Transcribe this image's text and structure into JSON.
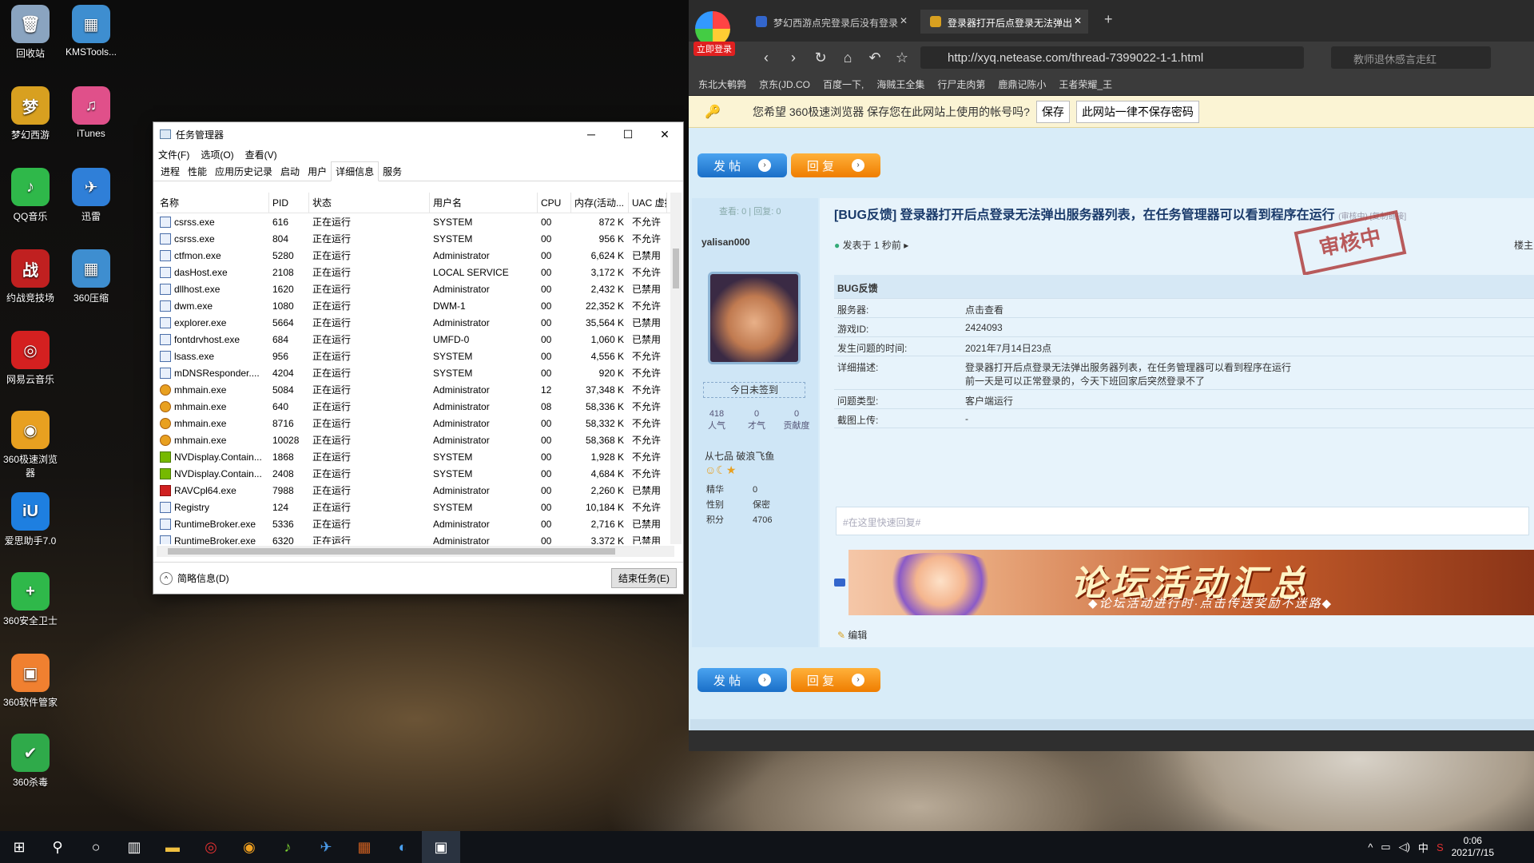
{
  "desktop": {
    "icons": [
      {
        "label": "回收站",
        "color": "#8aa4c0",
        "glyph": "🗑"
      },
      {
        "label": "KMSTools...",
        "color": "#3e8ed0",
        "glyph": "▦"
      },
      {
        "label": "梦幻西游",
        "color": "#d8a020",
        "glyph": "梦"
      },
      {
        "label": "iTunes",
        "color": "#e0508a",
        "glyph": "♫"
      },
      {
        "label": "QQ音乐",
        "color": "#2fb84a",
        "glyph": "♪"
      },
      {
        "label": "迅雷",
        "color": "#2f7fd8",
        "glyph": "✈"
      },
      {
        "label": "约战竞技场",
        "color": "#c02020",
        "glyph": "战"
      },
      {
        "label": "360压缩",
        "color": "#3e8ed0",
        "glyph": "▦"
      },
      {
        "label": "网易云音乐",
        "color": "#d42020",
        "glyph": "◎"
      },
      {
        "label": "360极速浏览器",
        "color": "#e8a020",
        "glyph": "◉"
      },
      {
        "label": "爱思助手7.0",
        "color": "#1e7fe0",
        "glyph": "iU"
      },
      {
        "label": "360安全卫士",
        "color": "#2fb84a",
        "glyph": "+"
      },
      {
        "label": "360软件管家",
        "color": "#f08030",
        "glyph": "▣"
      },
      {
        "label": "360杀毒",
        "color": "#2faa4a",
        "glyph": "✔"
      }
    ]
  },
  "task_manager": {
    "title": "任务管理器",
    "menu": [
      "文件(F)",
      "选项(O)",
      "查看(V)"
    ],
    "tabs": [
      "进程",
      "性能",
      "应用历史记录",
      "启动",
      "用户",
      "详细信息",
      "服务"
    ],
    "active_tab": "详细信息",
    "columns": [
      "名称",
      "PID",
      "状态",
      "用户名",
      "CPU",
      "内存(活动...",
      "UAC 虚拟"
    ],
    "rows": [
      [
        "csrss.exe",
        "616",
        "正在运行",
        "SYSTEM",
        "00",
        "872 K",
        "不允许"
      ],
      [
        "csrss.exe",
        "804",
        "正在运行",
        "SYSTEM",
        "00",
        "956 K",
        "不允许"
      ],
      [
        "ctfmon.exe",
        "5280",
        "正在运行",
        "Administrator",
        "00",
        "6,624 K",
        "已禁用"
      ],
      [
        "dasHost.exe",
        "2108",
        "正在运行",
        "LOCAL SERVICE",
        "00",
        "3,172 K",
        "不允许"
      ],
      [
        "dllhost.exe",
        "1620",
        "正在运行",
        "Administrator",
        "00",
        "2,432 K",
        "已禁用"
      ],
      [
        "dwm.exe",
        "1080",
        "正在运行",
        "DWM-1",
        "00",
        "22,352 K",
        "不允许"
      ],
      [
        "explorer.exe",
        "5664",
        "正在运行",
        "Administrator",
        "00",
        "35,564 K",
        "已禁用"
      ],
      [
        "fontdrvhost.exe",
        "684",
        "正在运行",
        "UMFD-0",
        "00",
        "1,060 K",
        "已禁用"
      ],
      [
        "lsass.exe",
        "956",
        "正在运行",
        "SYSTEM",
        "00",
        "4,556 K",
        "不允许"
      ],
      [
        "mDNSResponder....",
        "4204",
        "正在运行",
        "SYSTEM",
        "00",
        "920 K",
        "不允许"
      ],
      [
        "mhmain.exe",
        "5084",
        "正在运行",
        "Administrator",
        "12",
        "37,348 K",
        "不允许"
      ],
      [
        "mhmain.exe",
        "640",
        "正在运行",
        "Administrator",
        "08",
        "58,336 K",
        "不允许"
      ],
      [
        "mhmain.exe",
        "8716",
        "正在运行",
        "Administrator",
        "00",
        "58,332 K",
        "不允许"
      ],
      [
        "mhmain.exe",
        "10028",
        "正在运行",
        "Administrator",
        "00",
        "58,368 K",
        "不允许"
      ],
      [
        "NVDisplay.Contain...",
        "1868",
        "正在运行",
        "SYSTEM",
        "00",
        "1,928 K",
        "不允许"
      ],
      [
        "NVDisplay.Contain...",
        "2408",
        "正在运行",
        "SYSTEM",
        "00",
        "4,684 K",
        "不允许"
      ],
      [
        "RAVCpl64.exe",
        "7988",
        "正在运行",
        "Administrator",
        "00",
        "2,260 K",
        "已禁用"
      ],
      [
        "Registry",
        "124",
        "正在运行",
        "SYSTEM",
        "00",
        "10,184 K",
        "不允许"
      ],
      [
        "RuntimeBroker.exe",
        "5336",
        "正在运行",
        "Administrator",
        "00",
        "2,716 K",
        "已禁用"
      ],
      [
        "RuntimeBroker.exe",
        "6320",
        "正在运行",
        "Administrator",
        "00",
        "3,372 K",
        "已禁用"
      ]
    ],
    "footer_less": "简略信息(D)",
    "footer_end": "结束任务(E)"
  },
  "browser": {
    "login_badge": "立即登录",
    "tabs": [
      "梦幻西游点完登录后没有登录",
      "登录器打开后点登录无法弹出"
    ],
    "url": "http://xyq.netease.com/thread-7399022-1-1.html",
    "search_placeholder": "教师退休感言走红",
    "bookmarks": [
      "东北大鹌鹑",
      "京东(JD.CO",
      "百度一下,",
      "海贼王全集",
      "行尸走肉第",
      "鹿鼎记陈小",
      "王者荣耀_王"
    ],
    "password_prompt": "您希望 360极速浏览器 保存您在此网站上使用的帐号吗?",
    "save_btn": "保存",
    "never_btn": "此网站一律不保存密码",
    "post_btn": "发 帖",
    "reply_btn": "回 复",
    "views": "查看: 0",
    "replies": "回复: 0",
    "author": "yalisan000",
    "checkin": "今日未签到",
    "stats": [
      {
        "value": "418",
        "label": "人气"
      },
      {
        "value": "0",
        "label": "才气"
      },
      {
        "value": "0",
        "label": "贡献度"
      }
    ],
    "rank": "从七品 破浪飞鱼",
    "profile": [
      {
        "k": "精华",
        "v": "0"
      },
      {
        "k": "性别",
        "v": "保密"
      },
      {
        "k": "积分",
        "v": "4706"
      }
    ],
    "post_title": "[BUG反馈] 登录器打开后点登录无法弹出服务器列表，在任务管理器可以看到程序在运行",
    "title_tail": "(审核中) [复制链接]",
    "posted": "发表于 1 秒前",
    "floor": "楼主",
    "stamp": "审核中",
    "section": "BUG反馈",
    "fields": [
      {
        "k": "服务器:",
        "v": "点击查看"
      },
      {
        "k": "游戏ID:",
        "v": "2424093"
      },
      {
        "k": "发生问题的时间:",
        "v": "2021年7月14日23点"
      },
      {
        "k": "详细描述:",
        "v": "登录器打开后点登录无法弹出服务器列表，在任务管理器可以看到程序在运行",
        "v2": "前一天是可以正常登录的，今天下班回家后突然登录不了"
      },
      {
        "k": "问题类型:",
        "v": "客户端运行"
      },
      {
        "k": "截图上传:",
        "v": "-"
      }
    ],
    "quick_reply": "#在这里快速回复#",
    "banner_title": "论坛活动汇总",
    "banner_sub": "◆论坛活动进行时·点击传送奖励不迷路◆",
    "edit": "编辑"
  },
  "taskbar": {
    "time": "0:06",
    "date": "2021/7/15",
    "ime": "中"
  }
}
